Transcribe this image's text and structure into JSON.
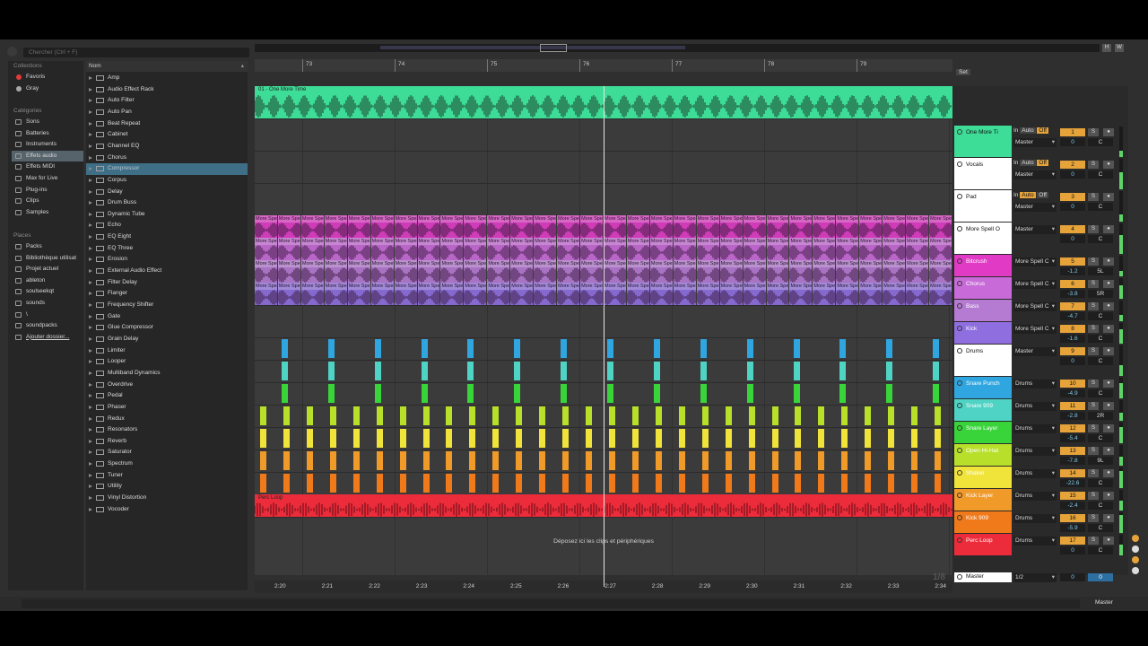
{
  "search": {
    "placeholder": "Chercher (Ctrl + F)"
  },
  "collections": {
    "heading": "Collections",
    "items": [
      {
        "label": "Favoris",
        "color": "#e43a3a"
      },
      {
        "label": "Gray",
        "color": "#a9a9a9"
      }
    ]
  },
  "categories": {
    "heading": "Catégories",
    "items": [
      {
        "label": "Sons",
        "selected": false
      },
      {
        "label": "Batteries",
        "selected": false
      },
      {
        "label": "Instruments",
        "selected": false
      },
      {
        "label": "Effets audio",
        "selected": true
      },
      {
        "label": "Effets MIDI",
        "selected": false
      },
      {
        "label": "Max for Live",
        "selected": false
      },
      {
        "label": "Plug-ins",
        "selected": false
      },
      {
        "label": "Clips",
        "selected": false
      },
      {
        "label": "Samples",
        "selected": false
      }
    ]
  },
  "places": {
    "heading": "Places",
    "items": [
      {
        "label": "Packs"
      },
      {
        "label": "Bibliothèque utilisat"
      },
      {
        "label": "Projet actuel"
      },
      {
        "label": "ableton"
      },
      {
        "label": "soulseekqt"
      },
      {
        "label": "sounds"
      },
      {
        "label": "\\"
      },
      {
        "label": "soundpacks"
      },
      {
        "label": "Ajouter dossier..."
      }
    ]
  },
  "browser_list": {
    "column": "Nom",
    "items": [
      {
        "label": "Amp"
      },
      {
        "label": "Audio Effect Rack"
      },
      {
        "label": "Auto Filter"
      },
      {
        "label": "Auto Pan"
      },
      {
        "label": "Beat Repeat"
      },
      {
        "label": "Cabinet"
      },
      {
        "label": "Channel EQ"
      },
      {
        "label": "Chorus"
      },
      {
        "label": "Compressor",
        "selected": true
      },
      {
        "label": "Corpus"
      },
      {
        "label": "Delay"
      },
      {
        "label": "Drum Buss"
      },
      {
        "label": "Dynamic Tube"
      },
      {
        "label": "Echo"
      },
      {
        "label": "EQ Eight"
      },
      {
        "label": "EQ Three"
      },
      {
        "label": "Erosion"
      },
      {
        "label": "External Audio Effect"
      },
      {
        "label": "Filter Delay"
      },
      {
        "label": "Flanger"
      },
      {
        "label": "Frequency Shifter"
      },
      {
        "label": "Gate"
      },
      {
        "label": "Glue Compressor"
      },
      {
        "label": "Grain Delay"
      },
      {
        "label": "Limiter"
      },
      {
        "label": "Looper"
      },
      {
        "label": "Multiband Dynamics"
      },
      {
        "label": "Overdrive"
      },
      {
        "label": "Pedal"
      },
      {
        "label": "Phaser"
      },
      {
        "label": "Redux"
      },
      {
        "label": "Resonators"
      },
      {
        "label": "Reverb"
      },
      {
        "label": "Saturator"
      },
      {
        "label": "Spectrum"
      },
      {
        "label": "Tuner"
      },
      {
        "label": "Utility"
      },
      {
        "label": "Vinyl Distortion"
      },
      {
        "label": "Vocoder"
      }
    ]
  },
  "bar_ruler": [
    "73",
    "74",
    "75",
    "76",
    "77",
    "78",
    "79"
  ],
  "time_ruler": [
    "2:20",
    "2:21",
    "2:22",
    "2:23",
    "2:24",
    "2:25",
    "2:26",
    "2:27",
    "2:28",
    "2:29",
    "2:30",
    "2:31",
    "2:32",
    "2:33",
    "2:34"
  ],
  "arrangement": {
    "drop_hint": "Déposez ici les clips et périphériques",
    "set_label": "Set",
    "quant": "1/8",
    "first_clip": "01 - One More Time",
    "clip_label": "More Spell On You",
    "perc_clip": "Perc Loop"
  },
  "tracks": [
    {
      "name": "One More Ti",
      "color": "#3ddc97",
      "io": [
        "In",
        "Auto",
        "Off"
      ],
      "route": "Master",
      "num": "1",
      "vol": "0",
      "pan": "C"
    },
    {
      "name": "Vocals",
      "color": "#ffffff",
      "io": [
        "In",
        "Auto",
        "Off"
      ],
      "route": "Master",
      "num": "2",
      "vol": "0",
      "pan": "C"
    },
    {
      "name": "Pad",
      "color": "#ffffff",
      "io": [
        "In",
        "Auto",
        "Off"
      ],
      "route": "Master",
      "num": "3",
      "vol": "0",
      "pan": "C"
    },
    {
      "name": "More Spell O",
      "color": "#ffffff",
      "route": "Master",
      "num": "4",
      "vol": "0",
      "pan": "C"
    },
    {
      "name": "Bitcrush",
      "color": "#e13bc6",
      "route": "More Spell C",
      "num": "5",
      "vol": "-1.2",
      "pan": "5L"
    },
    {
      "name": "Chorus",
      "color": "#c86bd8",
      "route": "More Spell C",
      "num": "6",
      "vol": "-3.8",
      "pan": "5R"
    },
    {
      "name": "Bass",
      "color": "#b57ad2",
      "route": "More Spell C",
      "num": "7",
      "vol": "-4.7",
      "pan": "C"
    },
    {
      "name": "Kick",
      "color": "#8f6ee0",
      "route": "More Spell C",
      "num": "8",
      "vol": "-1.6",
      "pan": "C"
    },
    {
      "name": "Drums",
      "color": "#ffffff",
      "route": "Master",
      "num": "9",
      "vol": "0",
      "pan": "C"
    },
    {
      "name": "Snare Punch",
      "color": "#2fa6e0",
      "route": "Drums",
      "num": "10",
      "vol": "-4.9",
      "pan": "C"
    },
    {
      "name": "Snare 909",
      "color": "#4fd3c4",
      "route": "Drums",
      "num": "11",
      "vol": "-2.8",
      "pan": "2R"
    },
    {
      "name": "Snare Layer",
      "color": "#39d43a",
      "route": "Drums",
      "num": "12",
      "vol": "-5.4",
      "pan": "C"
    },
    {
      "name": "Open Hi-Hat",
      "color": "#b8e02a",
      "route": "Drums",
      "num": "13",
      "vol": "-7.8",
      "pan": "9L"
    },
    {
      "name": "Shaker",
      "color": "#f0e43a",
      "route": "Drums",
      "num": "14",
      "vol": "-22.6",
      "pan": "C"
    },
    {
      "name": "Kick Layer",
      "color": "#f09a2a",
      "route": "Drums",
      "num": "15",
      "vol": "-2.4",
      "pan": "C"
    },
    {
      "name": "Kick 909",
      "color": "#f07a1a",
      "route": "Drums",
      "num": "16",
      "vol": "-5.9",
      "pan": "C"
    },
    {
      "name": "Perc Loop",
      "color": "#ec2c3a",
      "route": "Drums",
      "num": "17",
      "vol": "0",
      "pan": "C"
    }
  ],
  "master": {
    "name": "Master",
    "route": "1/2",
    "vol": "0",
    "pan": "0"
  },
  "status": {
    "right": "Master"
  },
  "colors": {
    "accent": "#e6a33a",
    "selection": "#3f6f87"
  }
}
